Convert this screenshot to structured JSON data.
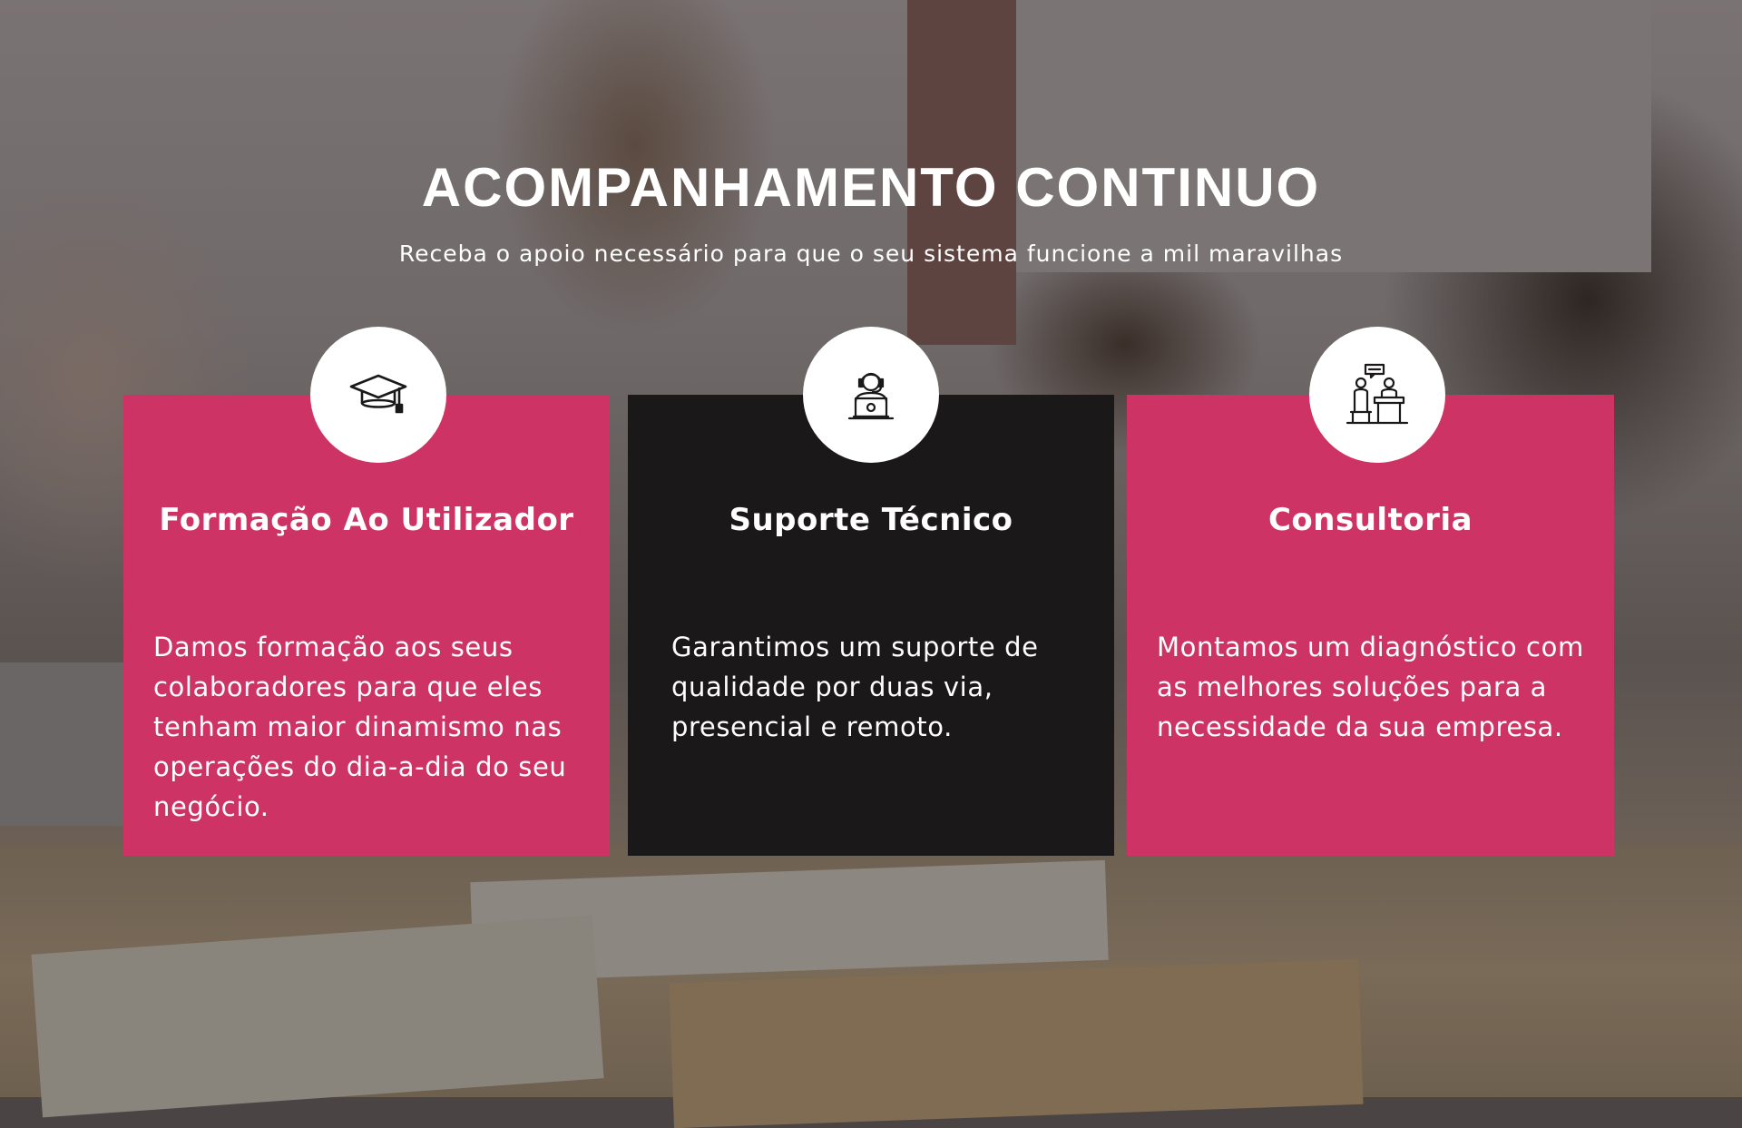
{
  "header": {
    "title": "ACOMPANHAMENTO CONTINUO",
    "subtitle": "Receba o apoio necessário para que o seu sistema funcione a mil maravilhas"
  },
  "cards": [
    {
      "icon": "graduation-cap-icon",
      "title": "Formação Ao Utilizador",
      "text": "Damos formação aos seus colaboradores para que eles tenham maior dinamismo nas operações do dia-a-dia do seu negócio.",
      "color": "#cd3365"
    },
    {
      "icon": "support-agent-icon",
      "title": "Suporte Técnico",
      "text": "Garantimos um suporte de qualidade por duas via, presencial e remoto.",
      "color": "#1a1818"
    },
    {
      "icon": "consultation-icon",
      "title": "Consultoria",
      "text": "Montamos um diagnóstico com as melhores soluções para a necessidade da sua empresa.",
      "color": "#cd3365"
    }
  ]
}
